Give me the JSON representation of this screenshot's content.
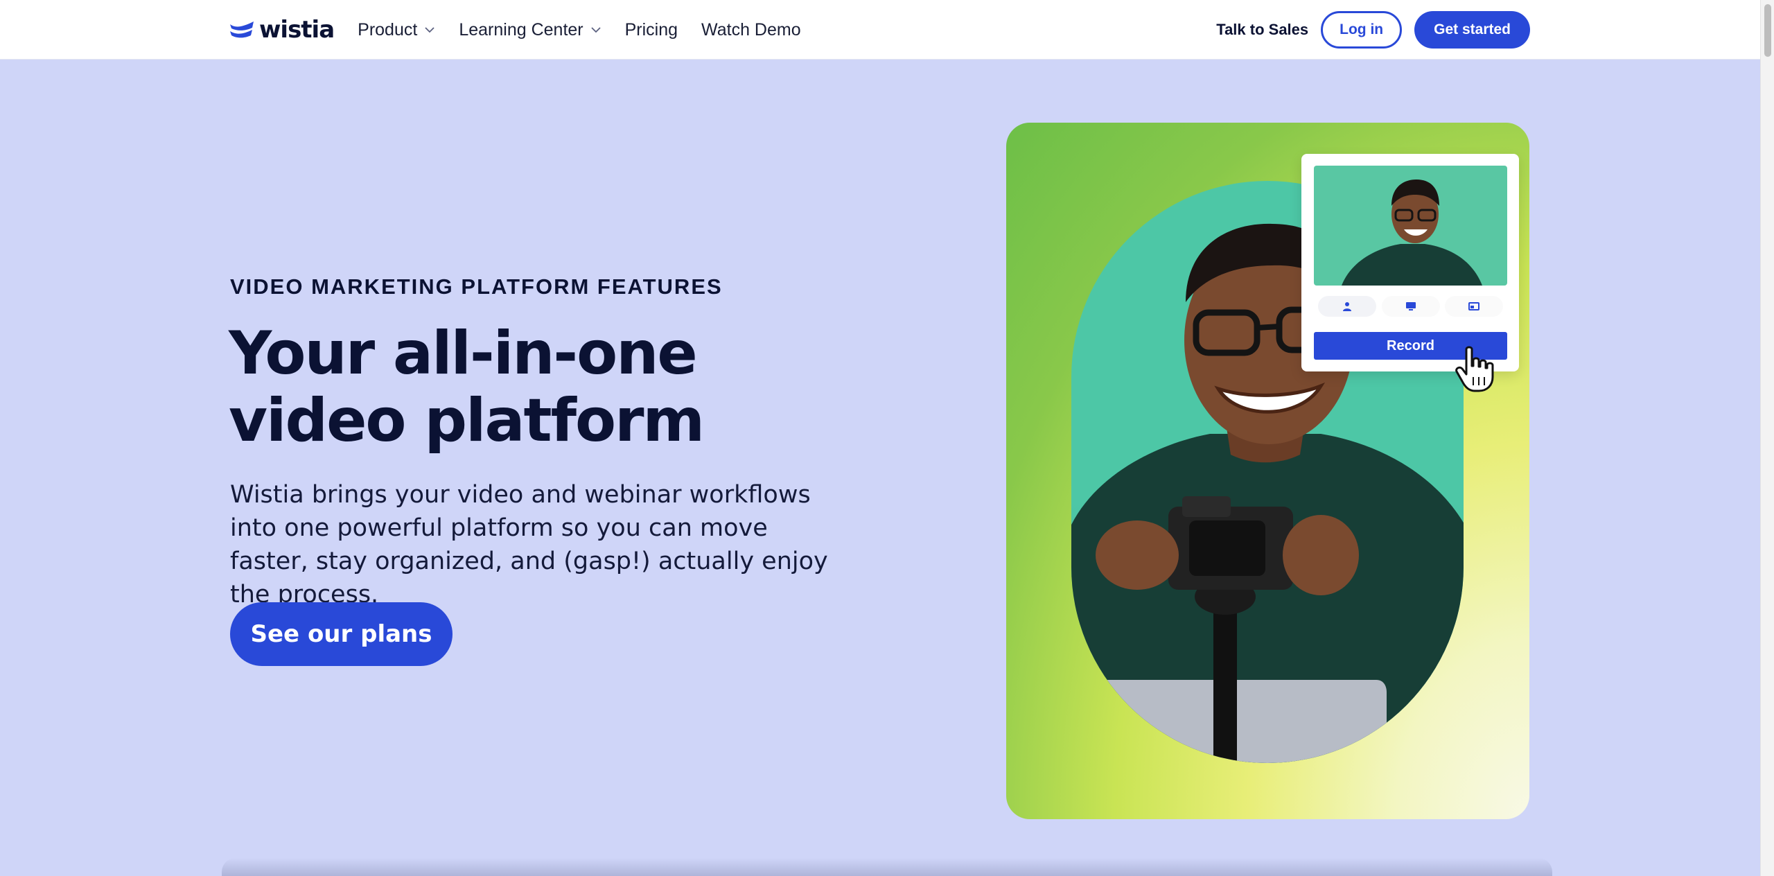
{
  "nav": {
    "logo_text": "wistia",
    "links": [
      {
        "label": "Product",
        "has_dropdown": true
      },
      {
        "label": "Learning Center",
        "has_dropdown": true
      },
      {
        "label": "Pricing",
        "has_dropdown": false
      },
      {
        "label": "Watch Demo",
        "has_dropdown": false
      }
    ],
    "talk_to_sales": "Talk to Sales",
    "login": "Log in",
    "get_started": "Get started"
  },
  "hero": {
    "eyebrow": "VIDEO MARKETING PLATFORM FEATURES",
    "headline_line1": "Your all-in-one",
    "headline_line2": "video platform",
    "subcopy": "Wistia brings your video and webinar workflows into one powerful platform so you can move faster, stay organized, and (gasp!) actually enjoy the process.",
    "cta": "See our plans"
  },
  "recorder": {
    "record_label": "Record",
    "modes": [
      "person-icon",
      "screen-icon",
      "screen-and-camera-icon"
    ]
  },
  "colors": {
    "brand_blue": "#2949d8",
    "page_bg": "#cfd5f8",
    "ink": "#0b1233"
  }
}
